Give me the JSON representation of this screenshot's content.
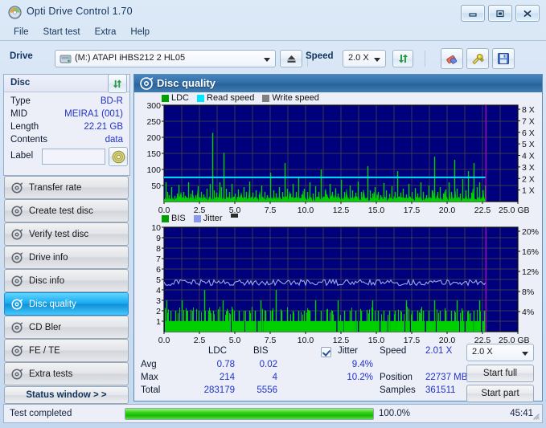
{
  "window": {
    "title": "Opti Drive Control 1.70",
    "icon": "disc-icon",
    "buttons": {
      "minimize": "minimize-icon",
      "maximize": "maximize-icon",
      "close": "close-icon"
    }
  },
  "menu": {
    "items": [
      "File",
      "Start test",
      "Extra",
      "Help"
    ]
  },
  "toolbar": {
    "drive_label": "Drive",
    "drive_value": "(M:)  ATAPI iHBS212  2 HL05",
    "eject_icon": "eject-icon",
    "speed_label": "Speed",
    "speed_value": "2.0 X",
    "refresh_icon": "refresh-icon",
    "eraser_icon": "eraser-icon",
    "tools_icon": "tools-icon",
    "save_icon": "save-icon"
  },
  "disc_panel": {
    "title": "Disc",
    "refresh_icon": "refresh-icon",
    "rows": [
      {
        "key": "Type",
        "value": "BD-R"
      },
      {
        "key": "MID",
        "value": "MEIRA1 (001)"
      },
      {
        "key": "Length",
        "value": "22.21 GB"
      },
      {
        "key": "Contents",
        "value": "data"
      }
    ],
    "label_key": "Label",
    "label_value": "",
    "label_placeholder": "",
    "disc_button_icon": "cd-icon"
  },
  "sidebar": {
    "items": [
      {
        "label": "Transfer rate",
        "icon": "disc-icon",
        "active": false
      },
      {
        "label": "Create test disc",
        "icon": "disc-icon",
        "active": false
      },
      {
        "label": "Verify test disc",
        "icon": "disc-icon",
        "active": false
      },
      {
        "label": "Drive info",
        "icon": "disc-icon",
        "active": false
      },
      {
        "label": "Disc info",
        "icon": "disc-icon",
        "active": false
      },
      {
        "label": "Disc quality",
        "icon": "disc-icon",
        "active": true
      },
      {
        "label": "CD Bler",
        "icon": "disc-icon",
        "active": false
      },
      {
        "label": "FE / TE",
        "icon": "disc-icon",
        "active": false
      },
      {
        "label": "Extra tests",
        "icon": "disc-icon",
        "active": false
      }
    ],
    "status_window_button": "Status window > >"
  },
  "content": {
    "title": "Disc quality",
    "title_icon": "disc-icon"
  },
  "stats": {
    "col_headers": [
      "LDC",
      "BIS"
    ],
    "row_headers": [
      "Avg",
      "Max",
      "Total"
    ],
    "ldc": {
      "avg": "0.78",
      "max": "214",
      "total": "283179"
    },
    "bis": {
      "avg": "0.02",
      "max": "4",
      "total": "5556"
    },
    "jitter": {
      "label": "Jitter",
      "checked": true,
      "avg": "9.4%",
      "max": "10.2%"
    },
    "speed_label": "Speed",
    "speed_value": "2.01 X",
    "position_label": "Position",
    "position_value": "22737 MB",
    "samples_label": "Samples",
    "samples_value": "361511",
    "speed_select": "2.0 X",
    "start_full": "Start full",
    "start_part": "Start part"
  },
  "statusbar": {
    "message": "Test completed",
    "percent_text": "100.0%",
    "percent_value": 100,
    "elapsed": "45:41"
  },
  "chart_data": [
    {
      "type": "line",
      "name": "ldc-chart",
      "title": "Disc quality - LDC",
      "legend": [
        {
          "label": "LDC",
          "color": "#00a000"
        },
        {
          "label": "Read speed",
          "color": "#00e5ff"
        },
        {
          "label": "Write speed",
          "color": "#808080"
        }
      ],
      "legend_position": "top-left",
      "xlabel": "GB",
      "x_ticks": [
        "0.0",
        "2.5",
        "5.0",
        "7.5",
        "10.0",
        "12.5",
        "15.0",
        "17.5",
        "20.0",
        "22.5",
        "25.0 GB"
      ],
      "xlim": [
        0,
        25
      ],
      "ylabel_left": "LDC",
      "y_ticks_left": [
        "50",
        "100",
        "150",
        "200",
        "250",
        "300"
      ],
      "ylim_left": [
        0,
        300
      ],
      "ylabel_right": "Speed",
      "y_ticks_right": [
        "1 X",
        "2 X",
        "3 X",
        "4 X",
        "5 X",
        "6 X",
        "7 X",
        "8 X"
      ],
      "ylim_right": [
        0,
        8
      ],
      "grid": true,
      "plot_bg": "#00007c",
      "data_end_marker_gb": 22.74,
      "read_speed_constant": 2.01,
      "series": [
        {
          "name": "LDC",
          "color": "#00d000",
          "spikes": [
            [
              0.1,
              60
            ],
            [
              0.22,
              30
            ],
            [
              0.35,
              20
            ],
            [
              0.5,
              45
            ],
            [
              0.72,
              18
            ],
            [
              0.9,
              25
            ],
            [
              1.05,
              52
            ],
            [
              1.2,
              22
            ],
            [
              1.35,
              30
            ],
            [
              1.5,
              18
            ],
            [
              1.7,
              60
            ],
            [
              1.85,
              24
            ],
            [
              2.0,
              35
            ],
            [
              2.2,
              20
            ],
            [
              2.4,
              48
            ],
            [
              2.6,
              30
            ],
            [
              2.8,
              22
            ],
            [
              3.0,
              40
            ],
            [
              3.25,
              55
            ],
            [
              3.4,
              214
            ],
            [
              3.55,
              35
            ],
            [
              3.7,
              28
            ],
            [
              3.9,
              60
            ],
            [
              4.05,
              45
            ],
            [
              4.2,
              152
            ],
            [
              4.4,
              40
            ],
            [
              4.6,
              30
            ],
            [
              4.8,
              55
            ],
            [
              5.0,
              25
            ],
            [
              5.2,
              38
            ],
            [
              5.4,
              20
            ],
            [
              5.6,
              45
            ],
            [
              5.8,
              30
            ],
            [
              6.0,
              62
            ],
            [
              6.25,
              28
            ],
            [
              6.5,
              35
            ],
            [
              6.7,
              22
            ],
            [
              6.9,
              50
            ],
            [
              7.1,
              30
            ],
            [
              7.3,
              20
            ],
            [
              7.5,
              90
            ],
            [
              7.7,
              35
            ],
            [
              7.9,
              26
            ],
            [
              8.1,
              45
            ],
            [
              8.35,
              30
            ],
            [
              8.5,
              120
            ],
            [
              8.7,
              40
            ],
            [
              8.9,
              25
            ],
            [
              9.1,
              55
            ],
            [
              9.3,
              30
            ],
            [
              9.5,
              75
            ],
            [
              9.7,
              22
            ],
            [
              9.9,
              40
            ],
            [
              10.1,
              30
            ],
            [
              10.3,
              60
            ],
            [
              10.5,
              25
            ],
            [
              10.7,
              48
            ],
            [
              10.9,
              30
            ],
            [
              11.1,
              100
            ],
            [
              11.35,
              35
            ],
            [
              11.5,
              22
            ],
            [
              11.7,
              55
            ],
            [
              11.9,
              30
            ],
            [
              12.1,
              42
            ],
            [
              12.3,
              25
            ],
            [
              12.5,
              68
            ],
            [
              12.7,
              30
            ],
            [
              12.9,
              20
            ],
            [
              13.1,
              50
            ],
            [
              13.3,
              35
            ],
            [
              13.5,
              28
            ],
            [
              13.7,
              62
            ],
            [
              13.9,
              30
            ],
            [
              14.1,
              22
            ],
            [
              14.35,
              110
            ],
            [
              14.55,
              35
            ],
            [
              14.7,
              25
            ],
            [
              14.9,
              45
            ],
            [
              15.1,
              30
            ],
            [
              15.3,
              20
            ],
            [
              15.5,
              58
            ],
            [
              15.7,
              35
            ],
            [
              15.9,
              24
            ],
            [
              16.1,
              48
            ],
            [
              16.3,
              30
            ],
            [
              16.5,
              95
            ],
            [
              16.7,
              28
            ],
            [
              16.9,
              40
            ],
            [
              17.1,
              22
            ],
            [
              17.3,
              55
            ],
            [
              17.5,
              30
            ],
            [
              17.7,
              42
            ],
            [
              17.9,
              25
            ],
            [
              18.1,
              60
            ],
            [
              18.3,
              30
            ],
            [
              18.5,
              20
            ],
            [
              18.7,
              50
            ],
            [
              18.9,
              35
            ],
            [
              19.1,
              140
            ],
            [
              19.3,
              30
            ],
            [
              19.5,
              45
            ],
            [
              19.7,
              25
            ],
            [
              19.9,
              38
            ],
            [
              20.1,
              60
            ],
            [
              20.3,
              30
            ],
            [
              20.5,
              130
            ],
            [
              20.7,
              40
            ],
            [
              20.9,
              25
            ],
            [
              21.1,
              70
            ],
            [
              21.3,
              35
            ],
            [
              21.5,
              95
            ],
            [
              21.7,
              28
            ],
            [
              21.9,
              120
            ],
            [
              22.1,
              45
            ],
            [
              22.3,
              60
            ],
            [
              22.5,
              35
            ],
            [
              22.65,
              50
            ]
          ]
        }
      ]
    },
    {
      "type": "line",
      "name": "bis-chart",
      "title": "Disc quality - BIS / Jitter",
      "legend": [
        {
          "label": "BIS",
          "color": "#00a000"
        },
        {
          "label": "Jitter",
          "color": "#8899ee"
        }
      ],
      "legend_position": "top-left",
      "xlabel": "GB",
      "x_ticks": [
        "0.0",
        "2.5",
        "5.0",
        "7.5",
        "10.0",
        "12.5",
        "15.0",
        "17.5",
        "20.0",
        "22.5",
        "25.0 GB"
      ],
      "xlim": [
        0,
        25
      ],
      "ylabel_left": "BIS",
      "y_ticks_left": [
        "1",
        "2",
        "3",
        "4",
        "5",
        "6",
        "7",
        "8",
        "9",
        "10"
      ],
      "ylim_left": [
        0,
        10
      ],
      "ylabel_right": "Jitter",
      "y_ticks_right": [
        "4%",
        "8%",
        "12%",
        "16%",
        "20%"
      ],
      "ylim_right": [
        0,
        20
      ],
      "grid": true,
      "plot_bg": "#00007c",
      "data_end_marker_gb": 22.74,
      "jitter_mean": 9.4,
      "series": [
        {
          "name": "BIS",
          "color": "#00d000",
          "baseline": 1,
          "spikes": [
            [
              0.15,
              3
            ],
            [
              0.45,
              2
            ],
            [
              0.8,
              2
            ],
            [
              1.25,
              3
            ],
            [
              1.6,
              2
            ],
            [
              2.0,
              2
            ],
            [
              2.45,
              2
            ],
            [
              2.85,
              4
            ],
            [
              3.15,
              2
            ],
            [
              3.45,
              2
            ],
            [
              3.8,
              2
            ],
            [
              4.15,
              3
            ],
            [
              4.5,
              2
            ],
            [
              4.95,
              2
            ],
            [
              5.3,
              2
            ],
            [
              5.6,
              2
            ],
            [
              6.0,
              2
            ],
            [
              6.4,
              2
            ],
            [
              6.8,
              3
            ],
            [
              7.15,
              2
            ],
            [
              7.5,
              2
            ],
            [
              7.9,
              4
            ],
            [
              8.3,
              2
            ],
            [
              8.7,
              2
            ],
            [
              9.1,
              2
            ],
            [
              9.5,
              2
            ],
            [
              9.9,
              2
            ],
            [
              10.3,
              2
            ],
            [
              10.7,
              3
            ],
            [
              11.1,
              2
            ],
            [
              11.5,
              2
            ],
            [
              11.9,
              2
            ],
            [
              12.3,
              3
            ],
            [
              12.7,
              2
            ],
            [
              13.1,
              2
            ],
            [
              13.5,
              2
            ],
            [
              13.9,
              2
            ],
            [
              14.3,
              2
            ],
            [
              14.7,
              3
            ],
            [
              15.1,
              2
            ],
            [
              15.5,
              2
            ],
            [
              15.9,
              2
            ],
            [
              16.3,
              2
            ],
            [
              16.7,
              2
            ],
            [
              17.1,
              3
            ],
            [
              17.5,
              2
            ],
            [
              17.9,
              2
            ],
            [
              18.3,
              2
            ],
            [
              18.7,
              2
            ],
            [
              19.1,
              3
            ],
            [
              19.5,
              2
            ],
            [
              19.9,
              2
            ],
            [
              20.3,
              2
            ],
            [
              20.7,
              3
            ],
            [
              21.1,
              2
            ],
            [
              21.5,
              2
            ],
            [
              21.9,
              2
            ],
            [
              22.3,
              3
            ],
            [
              22.6,
              2
            ]
          ]
        },
        {
          "name": "Jitter",
          "color": "#9aa8f0",
          "mean_percent": 9.4,
          "max_percent": 10.2
        }
      ]
    }
  ]
}
